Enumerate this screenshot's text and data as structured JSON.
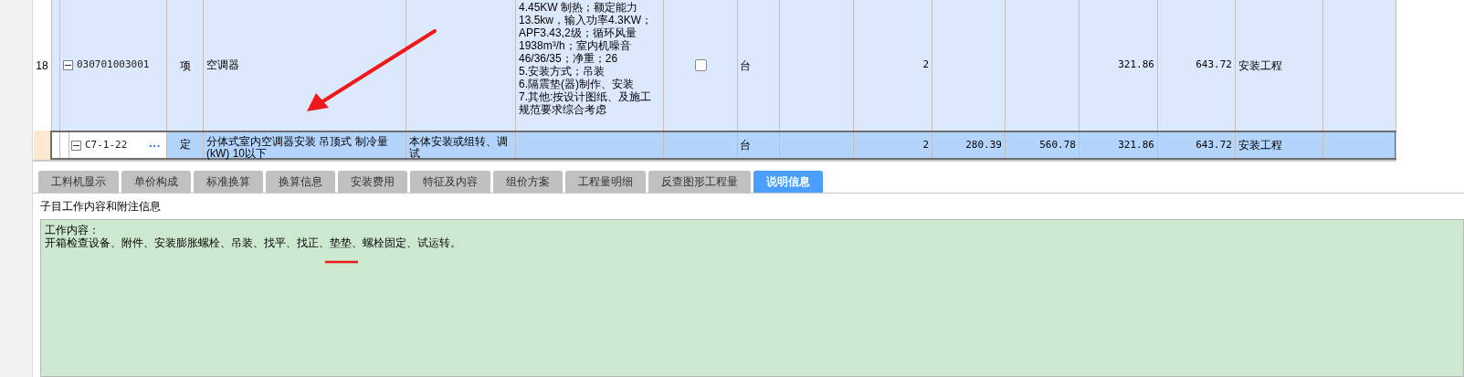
{
  "table": {
    "rows": [
      {
        "number": "18",
        "code": "030701003001",
        "expanded": true,
        "type": "项",
        "name": "空调器",
        "column_6": [
          "4.45KW 制热；额定能力",
          "13.5kw，输入功率4.3KW；",
          "APF3.43,2级；循环风量",
          "1938m³/h；室内机噪音",
          "46/36/35；净重；26",
          "5.安装方式；吊装",
          "6.隔震垫(器)制作、安装",
          "7.其他:按设计图纸、及施工",
          "规范要求综合考虑"
        ],
        "checkbox": {
          "checked": false
        },
        "unit": "台",
        "quantity": "2",
        "column_13": "321.86",
        "column_14": "643.72",
        "column_15": "安装工程",
        "selected": false
      },
      {
        "code": "C7-1-22",
        "expanded": true,
        "more_button": "···",
        "type": "定",
        "name": "分体式室内空调器安装 吊顶式 制冷量(kW) 10以下",
        "column_5": "本体安装或组转、调试",
        "unit": "台",
        "quantity": "2",
        "column_11": "280.39",
        "column_12": "560.78",
        "column_13": "321.86",
        "column_14": "643.72",
        "column_15": "安装工程",
        "selected": true
      }
    ]
  },
  "tabs": [
    {
      "label": "工料机显示",
      "selected": false
    },
    {
      "label": "单价构成",
      "selected": false
    },
    {
      "label": "标准换算",
      "selected": false
    },
    {
      "label": "换算信息",
      "selected": false
    },
    {
      "label": "安装费用",
      "selected": false
    },
    {
      "label": "特征及内容",
      "selected": false
    },
    {
      "label": "组价方案",
      "selected": false
    },
    {
      "label": "工程量明细",
      "selected": false
    },
    {
      "label": "反查图形工程量",
      "selected": false
    },
    {
      "label": "说明信息",
      "selected": true
    }
  ],
  "panel": {
    "title": "子目工作内容和附注信息",
    "lines": [
      "工作内容：",
      "开箱检查设备、附件、安装膨胀螺栓、吊装、找平、找正、垫垫、螺栓固定、试运转。"
    ]
  }
}
